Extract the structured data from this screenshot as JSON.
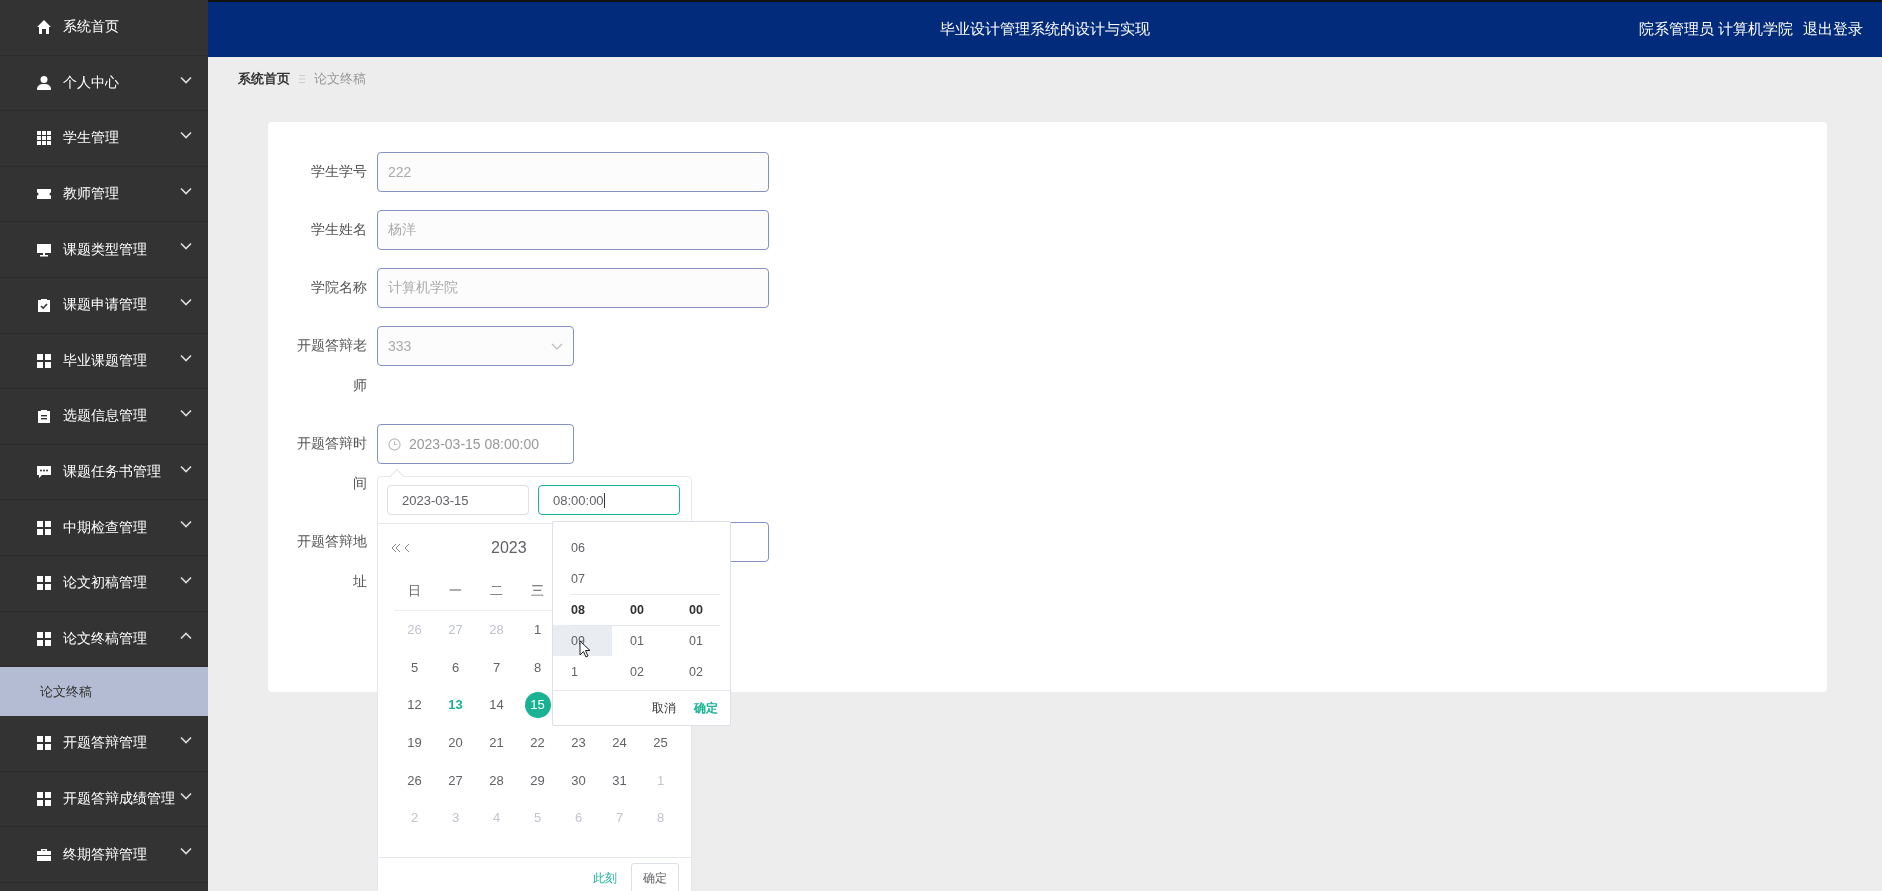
{
  "sidebar": {
    "items": [
      {
        "label": "系统首页"
      },
      {
        "label": "个人中心",
        "expanded": false
      },
      {
        "label": "学生管理",
        "expanded": false
      },
      {
        "label": "教师管理",
        "expanded": false
      },
      {
        "label": "课题类型管理",
        "expanded": false
      },
      {
        "label": "课题申请管理",
        "expanded": false
      },
      {
        "label": "毕业课题管理",
        "expanded": false
      },
      {
        "label": "选题信息管理",
        "expanded": false
      },
      {
        "label": "课题任务书管理",
        "expanded": false
      },
      {
        "label": "中期检查管理",
        "expanded": false
      },
      {
        "label": "论文初稿管理",
        "expanded": false
      },
      {
        "label": "论文终稿管理",
        "expanded": true,
        "children": [
          {
            "label": "论文终稿",
            "selected": true
          }
        ]
      },
      {
        "label": "开题答辩管理",
        "expanded": false
      },
      {
        "label": "开题答辩成绩管理",
        "expanded": false
      },
      {
        "label": "终期答辩管理",
        "expanded": false
      }
    ]
  },
  "header": {
    "title": "毕业设计管理系统的设计与实现",
    "user": "院系管理员 计算机学院",
    "logout": "退出登录"
  },
  "breadcrumb": [
    {
      "label": "系统首页",
      "current": false
    },
    {
      "label": "论文终稿",
      "current": true
    }
  ],
  "form": {
    "fields": [
      {
        "kind": "text",
        "label": "学生学号",
        "value": "222",
        "disabled": true
      },
      {
        "kind": "text",
        "label": "学生姓名",
        "value": "杨洋",
        "disabled": true
      },
      {
        "kind": "text",
        "label": "学院名称",
        "value": "计算机学院",
        "disabled": true
      },
      {
        "kind": "select",
        "label": "开题答辩老师",
        "value": "333",
        "disabled": true
      },
      {
        "kind": "datetime",
        "label": "开题答辩时间",
        "value": "2023-03-15 08:00:00"
      },
      {
        "kind": "text",
        "label": "开题答辩地址",
        "disabled": false
      }
    ]
  },
  "picker": {
    "date_input": "2023-03-15",
    "time_input": "08:00:00",
    "month_title": "2023",
    "weekdays": [
      "日",
      "一",
      "二",
      "三"
    ],
    "weeks": [
      [
        {
          "day": "26",
          "muted": true,
          "today": false,
          "selected": false
        },
        {
          "day": "27",
          "muted": true,
          "today": false,
          "selected": false
        },
        {
          "day": "28",
          "muted": true,
          "today": false,
          "selected": false
        },
        {
          "day": "1",
          "muted": false,
          "today": false,
          "selected": false
        }
      ],
      [
        {
          "day": "5",
          "muted": false,
          "today": false,
          "selected": false
        },
        {
          "day": "6",
          "muted": false,
          "today": false,
          "selected": false
        },
        {
          "day": "7",
          "muted": false,
          "today": false,
          "selected": false
        },
        {
          "day": "8",
          "muted": false,
          "today": false,
          "selected": false
        }
      ],
      [
        {
          "day": "12",
          "muted": false,
          "today": false,
          "selected": false
        },
        {
          "day": "13",
          "muted": false,
          "today": true,
          "selected": false
        },
        {
          "day": "14",
          "muted": false,
          "today": false,
          "selected": false
        },
        {
          "day": "15",
          "muted": false,
          "today": false,
          "selected": true
        }
      ],
      [
        {
          "day": "19",
          "muted": false,
          "today": false,
          "selected": false
        },
        {
          "day": "20",
          "muted": false,
          "today": false,
          "selected": false
        },
        {
          "day": "21",
          "muted": false,
          "today": false,
          "selected": false
        },
        {
          "day": "22",
          "muted": false,
          "today": false,
          "selected": false
        },
        {
          "day": "23",
          "muted": false,
          "today": false,
          "selected": false
        },
        {
          "day": "24",
          "muted": false,
          "today": false,
          "selected": false
        },
        {
          "day": "25",
          "muted": false,
          "today": false,
          "selected": false
        }
      ],
      [
        {
          "day": "26",
          "muted": false,
          "today": false,
          "selected": false
        },
        {
          "day": "27",
          "muted": false,
          "today": false,
          "selected": false
        },
        {
          "day": "28",
          "muted": false,
          "today": false,
          "selected": false
        },
        {
          "day": "29",
          "muted": false,
          "today": false,
          "selected": false
        },
        {
          "day": "30",
          "muted": false,
          "today": false,
          "selected": false
        },
        {
          "day": "31",
          "muted": false,
          "today": false,
          "selected": false
        },
        {
          "day": "1",
          "muted": true,
          "today": false,
          "selected": false
        }
      ],
      [
        {
          "day": "2",
          "muted": true,
          "today": false,
          "selected": false
        },
        {
          "day": "3",
          "muted": true,
          "today": false,
          "selected": false
        },
        {
          "day": "4",
          "muted": true,
          "today": false,
          "selected": false
        },
        {
          "day": "5",
          "muted": true,
          "today": false,
          "selected": false
        },
        {
          "day": "6",
          "muted": true,
          "today": false,
          "selected": false
        },
        {
          "day": "7",
          "muted": true,
          "today": false,
          "selected": false
        },
        {
          "day": "8",
          "muted": true,
          "today": false,
          "selected": false
        }
      ]
    ],
    "time_panel": {
      "hours": [
        {
          "value": "06",
          "selected": false,
          "hovered": false
        },
        {
          "value": "07",
          "selected": false,
          "hovered": false
        },
        {
          "value": "08",
          "selected": true,
          "hovered": false
        },
        {
          "value": "09",
          "selected": false,
          "hovered": true
        },
        {
          "value": "1",
          "selected": false,
          "hovered": false
        }
      ],
      "minutes": [
        {
          "value": "00",
          "selected": true,
          "hovered": false
        },
        {
          "value": "01",
          "selected": false,
          "hovered": false
        },
        {
          "value": "02",
          "selected": false,
          "hovered": false
        }
      ],
      "seconds": [
        {
          "value": "00",
          "selected": true,
          "hovered": false
        },
        {
          "value": "01",
          "selected": false,
          "hovered": false
        },
        {
          "value": "02",
          "selected": false,
          "hovered": false
        }
      ],
      "cancel": "取消",
      "confirm": "确定"
    },
    "now_button": "此刻",
    "ok_button": "确定"
  }
}
